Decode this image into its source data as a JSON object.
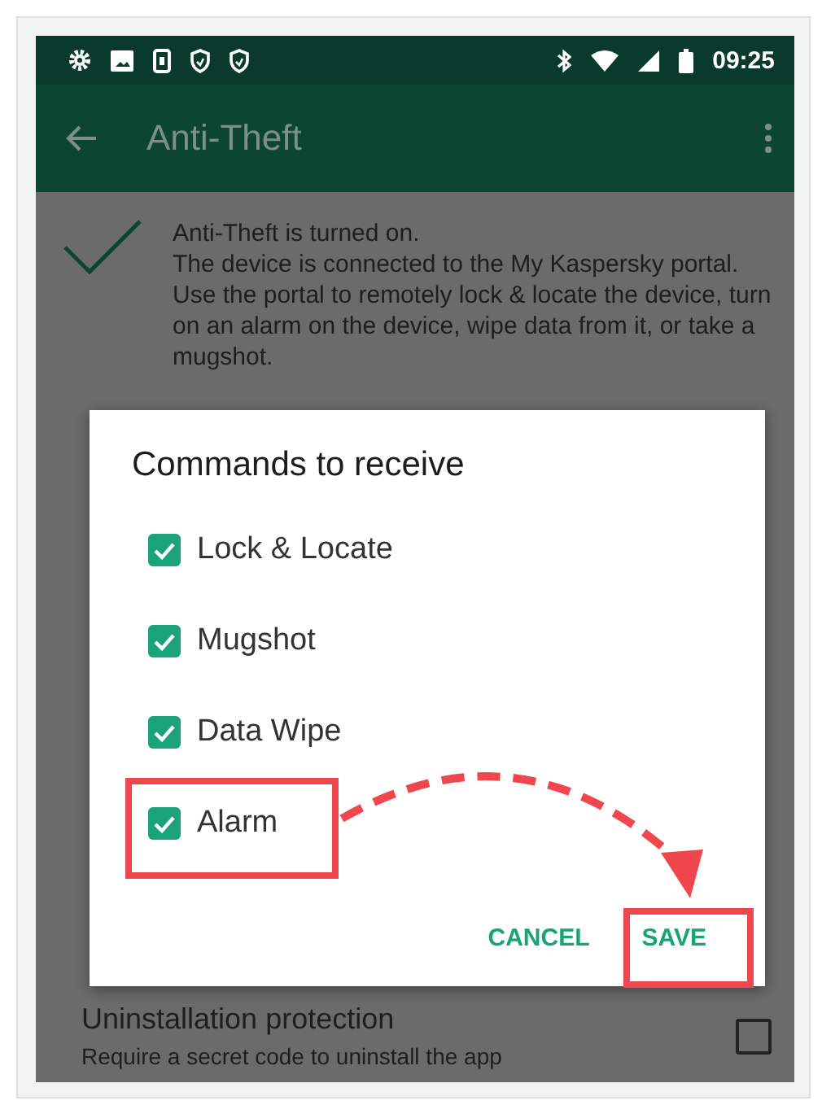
{
  "status_bar": {
    "time": "09:25"
  },
  "toolbar": {
    "title": "Anti-Theft"
  },
  "status": {
    "heading": "Anti-Theft is turned on.",
    "text": "The device is connected to the My Kaspersky portal. Use the portal to remotely lock & locate the device, turn on an alarm on the device, wipe data from it, or take a mugshot."
  },
  "settings": [
    {
      "title": "Uninstallation protection",
      "description": "Require a secret code to uninstall the app",
      "checked": false
    }
  ],
  "dialog": {
    "title": "Commands to receive",
    "options": [
      {
        "label": "Lock & Locate",
        "checked": true
      },
      {
        "label": "Mugshot",
        "checked": true
      },
      {
        "label": "Data Wipe",
        "checked": true
      },
      {
        "label": "Alarm",
        "checked": true
      }
    ],
    "buttons": [
      "CANCEL",
      "SAVE"
    ]
  }
}
